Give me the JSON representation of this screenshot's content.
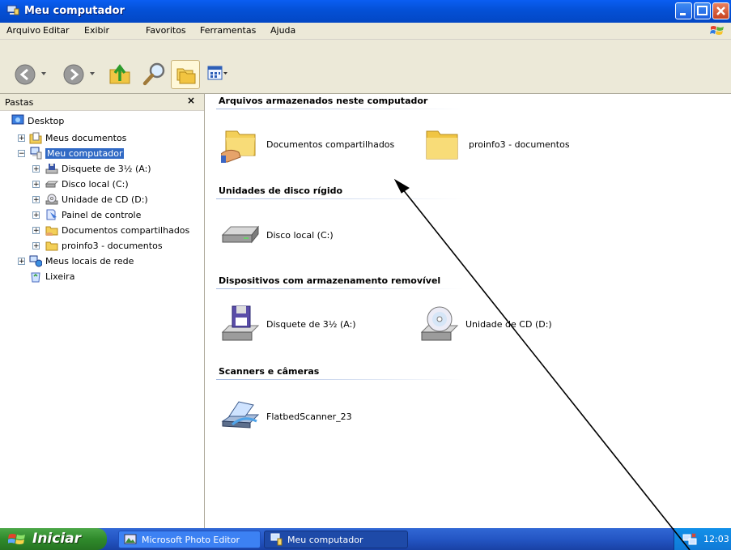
{
  "window": {
    "title": "Meu computador"
  },
  "menu": [
    "Arquivo",
    "Editar",
    "Exibir",
    "Favoritos",
    "Ferramentas",
    "Ajuda"
  ],
  "icons": {
    "back": "back-arrow-icon",
    "forward": "forward-arrow-icon",
    "up": "up-folder-icon",
    "search": "search-icon",
    "folders": "folders-icon",
    "views": "views-icon"
  },
  "folders_pane": {
    "title": "Pastas",
    "close_glyph": "×",
    "tree": [
      {
        "label": "Desktop",
        "icon": "desktop-icon"
      },
      {
        "label": "Meus documentos",
        "icon": "my-documents-icon",
        "expander": "+"
      },
      {
        "label": "Meu computador",
        "icon": "my-computer-icon",
        "expander": "−",
        "selected": true
      },
      {
        "label": "Disquete de 3½ (A:)",
        "icon": "floppy-drive-icon",
        "expander": "+"
      },
      {
        "label": "Disco local (C:)",
        "icon": "hard-disk-icon",
        "expander": "+"
      },
      {
        "label": "Unidade de CD (D:)",
        "icon": "cd-drive-icon",
        "expander": "+"
      },
      {
        "label": "Painel de controle",
        "icon": "control-panel-icon",
        "expander": "+"
      },
      {
        "label": "Documentos compartilhados",
        "icon": "shared-folder-icon",
        "expander": "+"
      },
      {
        "label": "proinfo3 - documentos",
        "icon": "folder-icon",
        "expander": "+"
      },
      {
        "label": "Meus locais de rede",
        "icon": "network-places-icon",
        "expander": "+"
      },
      {
        "label": "Lixeira",
        "icon": "recycle-bin-icon"
      }
    ]
  },
  "content": {
    "groups": [
      {
        "title": "Arquivos armazenados neste computador",
        "items": [
          {
            "label": "Documentos compartilhados",
            "icon": "shared-folder-icon"
          },
          {
            "label": "proinfo3 - documentos",
            "icon": "folder-icon"
          }
        ]
      },
      {
        "title": "Unidades de disco rígido",
        "items": [
          {
            "label": "Disco local (C:)",
            "icon": "hard-disk-icon"
          }
        ]
      },
      {
        "title": "Dispositivos com armazenamento removível",
        "items": [
          {
            "label": "Disquete de 3½ (A:)",
            "icon": "floppy-drive-icon"
          },
          {
            "label": "Unidade de CD (D:)",
            "icon": "cd-drive-icon"
          }
        ]
      },
      {
        "title": "Scanners e câmeras",
        "items": [
          {
            "label": "FlatbedScanner_23",
            "icon": "scanner-icon"
          }
        ]
      }
    ]
  },
  "taskbar": {
    "start_label": "Iniciar",
    "tasks": [
      {
        "label": "Microsoft Photo Editor",
        "icon": "photo-editor-icon"
      },
      {
        "label": "Meu computador",
        "icon": "my-computer-icon",
        "active": true
      }
    ],
    "clock": "12:03"
  },
  "colors": {
    "title_blue": "#0450d6",
    "selection": "#316ac5",
    "start_green": "#2f8a2b",
    "taskbar_blue": "#2456c4"
  }
}
